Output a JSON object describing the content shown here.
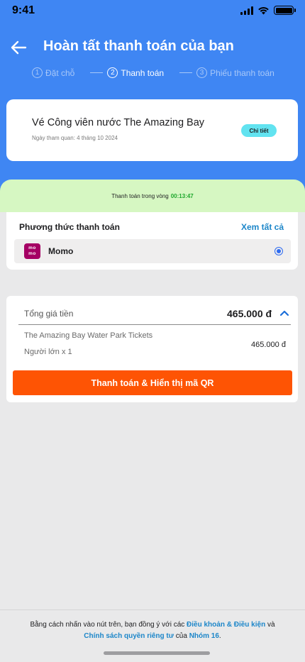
{
  "status_bar": {
    "time": "9:41"
  },
  "header": {
    "title": "Hoàn tất thanh toán của bạn",
    "steps": [
      {
        "number": "1",
        "label": "Đặt chỗ"
      },
      {
        "number": "2",
        "label": "Thanh toán"
      },
      {
        "number": "3",
        "label": "Phiếu thanh toán"
      }
    ],
    "active_step": 2
  },
  "ticket": {
    "name": "Vé Công viên nước The Amazing Bay",
    "visit_date": "Ngày tham quan: 4 tháng 10 2024",
    "detail_label": "Chi tiết"
  },
  "timer": {
    "label": "Thanh toán trong vòng",
    "value": "00:13:47"
  },
  "payment_method": {
    "title": "Phương thức thanh toán",
    "see_all": "Xem tất cả",
    "selected": {
      "name": "Momo",
      "logo_top": "mo",
      "logo_bottom": "mo",
      "brand_color": "#a50064"
    }
  },
  "summary": {
    "total_label": "Tổng giá tiền",
    "total_value": "465.000 đ",
    "item_name": "The Amazing Bay Water Park Tickets",
    "item_qty": "Người lớn x 1",
    "item_price": "465.000 đ",
    "pay_button": "Thanh toán & Hiển thị mã QR"
  },
  "footer": {
    "text_1": "Bằng cách nhấn vào nút trên, bạn đồng ý với các ",
    "terms_link": "Điều khoản & Điều kiện",
    "text_2": " và",
    "privacy_link": "Chính sách quyền riêng tư",
    "text_3": " của ",
    "group_link": "Nhóm 16",
    "text_4": "."
  },
  "colors": {
    "header_blue": "#3f86f3",
    "timer_bg": "#d6f7c2",
    "timer_green": "#1fa82d",
    "pay_orange": "#fe5404",
    "link_blue": "#1c86c9",
    "detail_cyan": "#62e3f0"
  }
}
